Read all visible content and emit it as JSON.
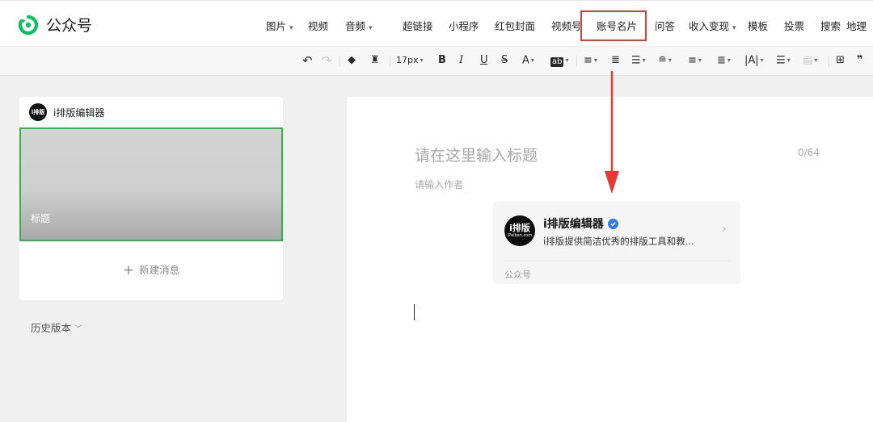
{
  "app": {
    "title": "公众号"
  },
  "top_menu": [
    {
      "label": "图片",
      "dropdown": true
    },
    {
      "label": "视频",
      "dropdown": false
    },
    {
      "label": "音频",
      "dropdown": true
    },
    {
      "label": "超链接",
      "dropdown": false
    },
    {
      "label": "小程序",
      "dropdown": false
    },
    {
      "label": "红包封面",
      "dropdown": false
    },
    {
      "label": "视频号",
      "dropdown": false
    },
    {
      "label": "账号名片",
      "dropdown": false,
      "highlighted": true
    },
    {
      "label": "问答",
      "dropdown": false
    },
    {
      "label": "收入变现",
      "dropdown": true
    },
    {
      "label": "模板",
      "dropdown": false
    },
    {
      "label": "投票",
      "dropdown": false
    },
    {
      "label": "搜索",
      "dropdown": false
    },
    {
      "label": "地理",
      "dropdown": false
    }
  ],
  "toolbar": {
    "font_size": "17px",
    "bold": "B",
    "italic": "I",
    "underline": "U",
    "strikethrough": "S",
    "font_color": "A",
    "bg_color": "ab"
  },
  "sidebar": {
    "account_name": "i排版编辑器",
    "avatar_text": "i排版",
    "article_cover_title": "标题",
    "new_message": "新建消息",
    "history": "历史版本"
  },
  "editor": {
    "title_placeholder": "请在这里输入标题",
    "title_counter": "0/64",
    "author_placeholder": "请输入作者"
  },
  "account_card": {
    "name": "i排版编辑器",
    "description": "i排版提供简洁优秀的排版工具和教...",
    "type": "公众号",
    "avatar_main": "i排版",
    "avatar_sub": "iPaiban.com",
    "verified": true
  },
  "colors": {
    "accent_green": "#2fb34a",
    "highlight_red": "#e53935",
    "verify_blue": "#2f7ce6"
  }
}
